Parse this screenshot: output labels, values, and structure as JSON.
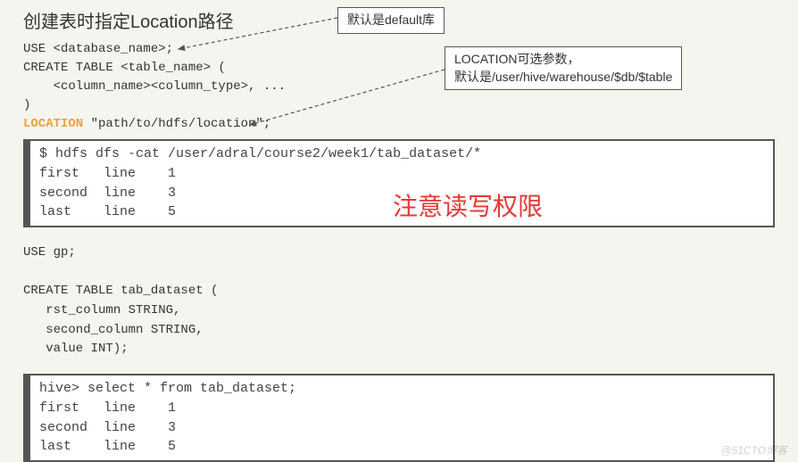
{
  "title": "创建表时指定Location路径",
  "code1": {
    "l1": "USE <database_name>;",
    "l2": "CREATE TABLE <table_name> (",
    "l3": "    <column_name><column_type>, ...",
    "l4": ")",
    "l5_kw": "LOCATION",
    "l5_rest": " \"path/to/hdfs/location\";"
  },
  "anno1": "默认是default库",
  "anno2_l1": "LOCATION可选参数，",
  "anno2_l2": "默认是/user/hive/warehouse/$db/$table",
  "terminal1": "$ hdfs dfs -cat /user/adral/course2/week1/tab_dataset/*\nfirst   line    1\nsecond  line    3\nlast    line    5",
  "warning": "注意读写权限",
  "code2": "USE gp;\n\nCREATE TABLE tab_dataset (\n   rst_column STRING,\n   second_column STRING,\n   value INT);",
  "terminal2": "hive> select * from tab_dataset;\nfirst   line    1\nsecond  line    3\nlast    line    5",
  "watermark": "@51CTO博客"
}
